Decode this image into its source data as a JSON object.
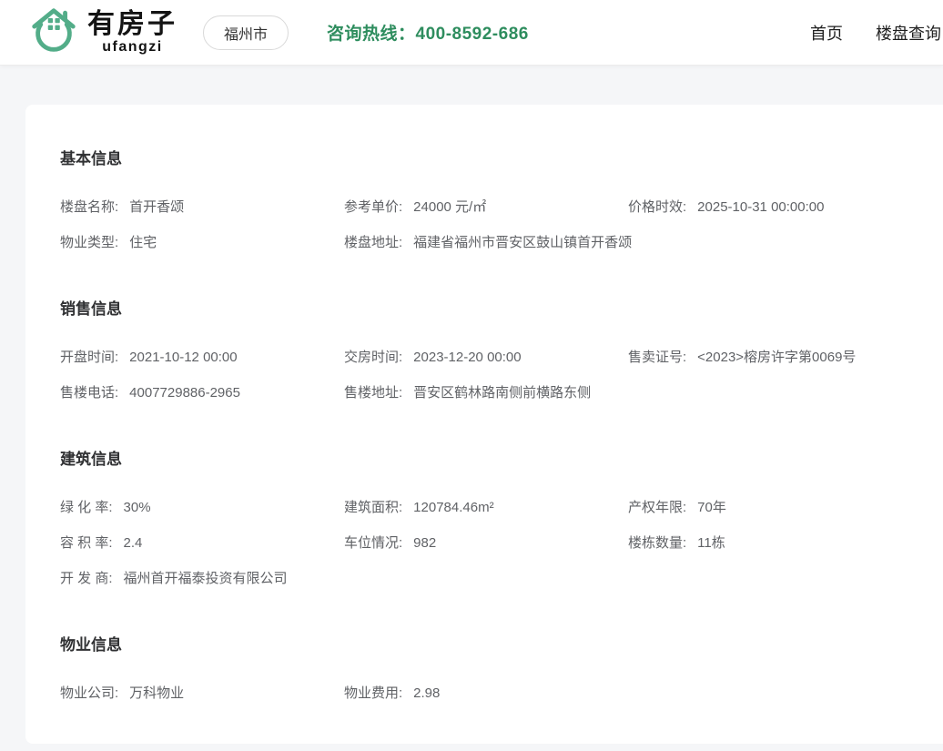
{
  "header": {
    "brand": {
      "name": "有房子",
      "slogan": "ufangzi"
    },
    "city_button_label": "福州市",
    "hotline": "咨询热线：400-8592-686",
    "nav": [
      {
        "label": "首页"
      },
      {
        "label": "楼盘查询"
      }
    ]
  },
  "colors": {
    "brand_green": "#53ad89",
    "hotline_green": "#2e8d5e",
    "title_text": "#303133",
    "body_text": "#606266",
    "page_background": "#f5f6f8"
  },
  "sections": [
    {
      "title": "基本信息",
      "rows": [
        [
          {
            "label": "楼盘名称:",
            "value": "首开香颂"
          },
          {
            "label": "参考单价:",
            "value": "24000 元/㎡"
          },
          {
            "label": "价格时效:",
            "value": "2025-10-31 00:00:00"
          }
        ],
        [
          {
            "label": "物业类型:",
            "value": "住宅"
          },
          {
            "label": "楼盘地址:",
            "value": "福建省福州市晋安区鼓山镇首开香颂"
          }
        ]
      ]
    },
    {
      "title": "销售信息",
      "rows": [
        [
          {
            "label": "开盘时间:",
            "value": "2021-10-12 00:00"
          },
          {
            "label": "交房时间:",
            "value": "2023-12-20 00:00"
          },
          {
            "label": "售卖证号:",
            "value": "<2023>榕房许字第0069号"
          }
        ],
        [
          {
            "label": "售楼电话:",
            "value": "4007729886-2965"
          },
          {
            "label": "售楼地址:",
            "value": "晋安区鹤林路南侧前横路东侧"
          }
        ]
      ]
    },
    {
      "title": "建筑信息",
      "rows": [
        [
          {
            "label": "绿 化 率:",
            "value": "30%"
          },
          {
            "label": "建筑面积:",
            "value": "120784.46m²"
          },
          {
            "label": "产权年限:",
            "value": "70年"
          }
        ],
        [
          {
            "label": "容 积 率:",
            "value": "2.4"
          },
          {
            "label": "车位情况:",
            "value": "982"
          },
          {
            "label": "楼栋数量:",
            "value": "11栋"
          }
        ],
        [
          {
            "label": "开 发 商:",
            "value": "福州首开福泰投资有限公司"
          }
        ]
      ]
    },
    {
      "title": "物业信息",
      "rows": [
        [
          {
            "label": "物业公司:",
            "value": "万科物业"
          },
          {
            "label": "物业费用:",
            "value": "2.98"
          }
        ]
      ]
    }
  ]
}
